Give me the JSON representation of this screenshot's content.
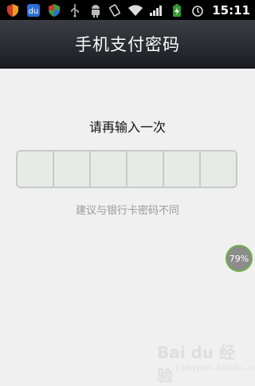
{
  "status_bar": {
    "time": "15:11",
    "left_icons": [
      "shield-icon",
      "baidu-app-icon",
      "shield-icon",
      "usb-icon",
      "android-icon"
    ],
    "right_icons": [
      "vibrate-icon",
      "wifi-icon",
      "signal-icon",
      "battery-charging-icon",
      "alarm-icon"
    ]
  },
  "header": {
    "title": "手机支付密码"
  },
  "main": {
    "prompt": "请再输入一次",
    "pin_cells": [
      "",
      "",
      "",
      "",
      "",
      ""
    ],
    "hint": "建议与银行卡密码不同"
  },
  "floating_badge": {
    "label": "79%"
  },
  "watermark": {
    "brand": "Bai du 经验",
    "url": "jingyan.baidu.com"
  },
  "colors": {
    "titlebar_top": "#3b3e44",
    "titlebar_bottom": "#1b1d21",
    "background": "#f0f0f0",
    "pin_fill": "#e6ebe6",
    "pin_border": "#c7cbc7",
    "hint_text": "#9a9a9a",
    "badge_ring": "#6fb04a"
  }
}
